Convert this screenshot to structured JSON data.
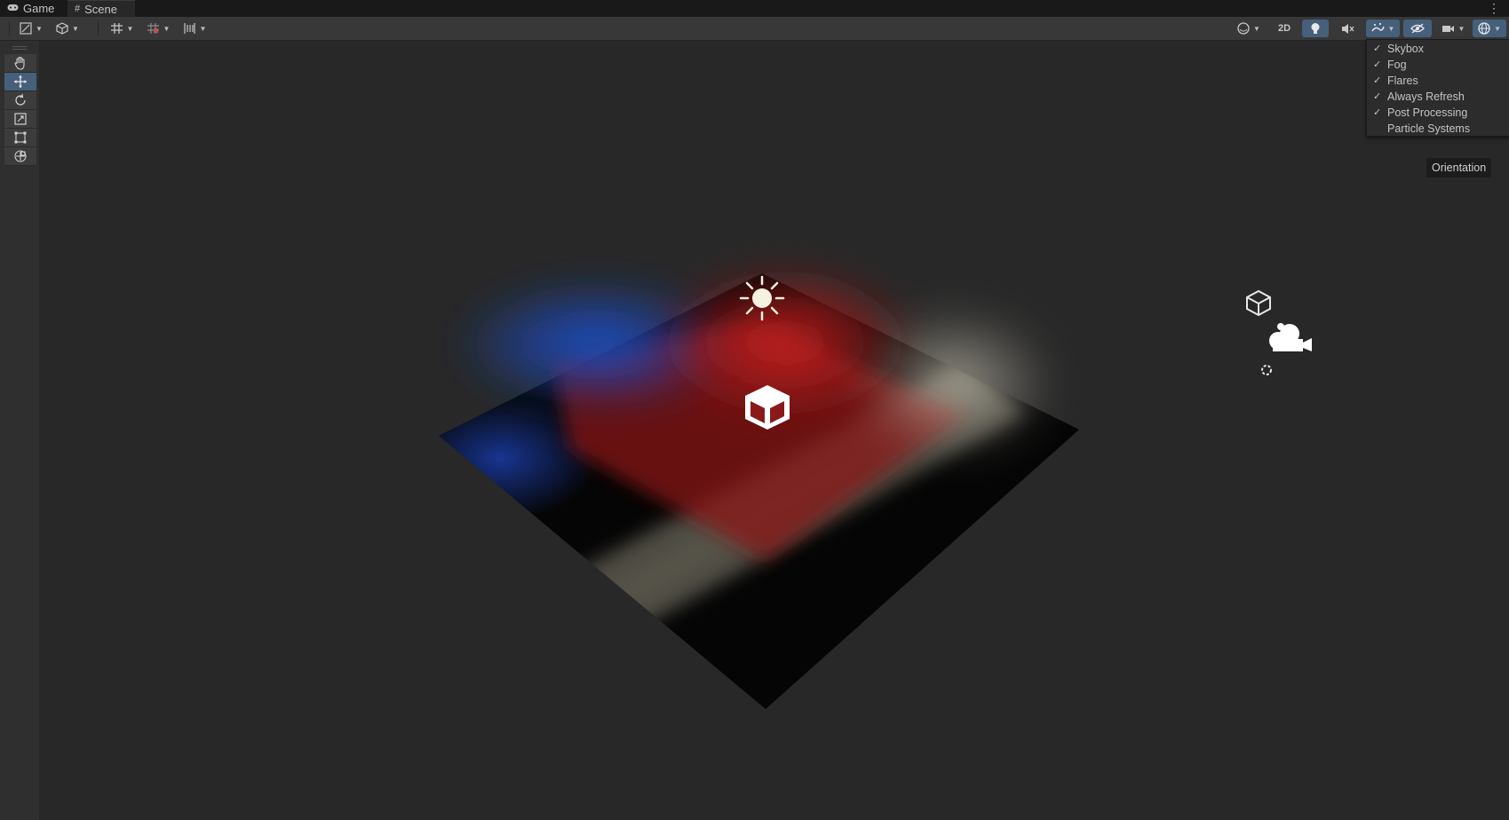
{
  "tabs": [
    {
      "label": "Game",
      "icon": "gamepad-icon"
    },
    {
      "label": "Scene",
      "icon": "hash-icon"
    }
  ],
  "toolbar": {
    "mode_2d_label": "2D"
  },
  "tools": [
    {
      "name": "hand-tool",
      "icon": "hand-icon"
    },
    {
      "name": "move-tool",
      "icon": "move-arrows-icon"
    },
    {
      "name": "rotate-tool",
      "icon": "rotate-icon"
    },
    {
      "name": "scale-tool",
      "icon": "scale-icon"
    },
    {
      "name": "rect-tool",
      "icon": "rect-transform-icon"
    },
    {
      "name": "transform-tool",
      "icon": "transform-icon"
    }
  ],
  "effects_menu": {
    "items": [
      {
        "label": "Skybox",
        "checked": true
      },
      {
        "label": "Fog",
        "checked": true
      },
      {
        "label": "Flares",
        "checked": true
      },
      {
        "label": "Always Refresh",
        "checked": true
      },
      {
        "label": "Post Processing",
        "checked": true
      },
      {
        "label": "Particle Systems",
        "checked": false
      }
    ],
    "check_glyph": "✓"
  },
  "orientation_label": "Orientation",
  "colors": {
    "accent": "#46607c",
    "scene_bg": "#282828",
    "red_light": "#c81e1e",
    "blue_light": "#1e50c8",
    "white_light": "#d2cdbc"
  }
}
